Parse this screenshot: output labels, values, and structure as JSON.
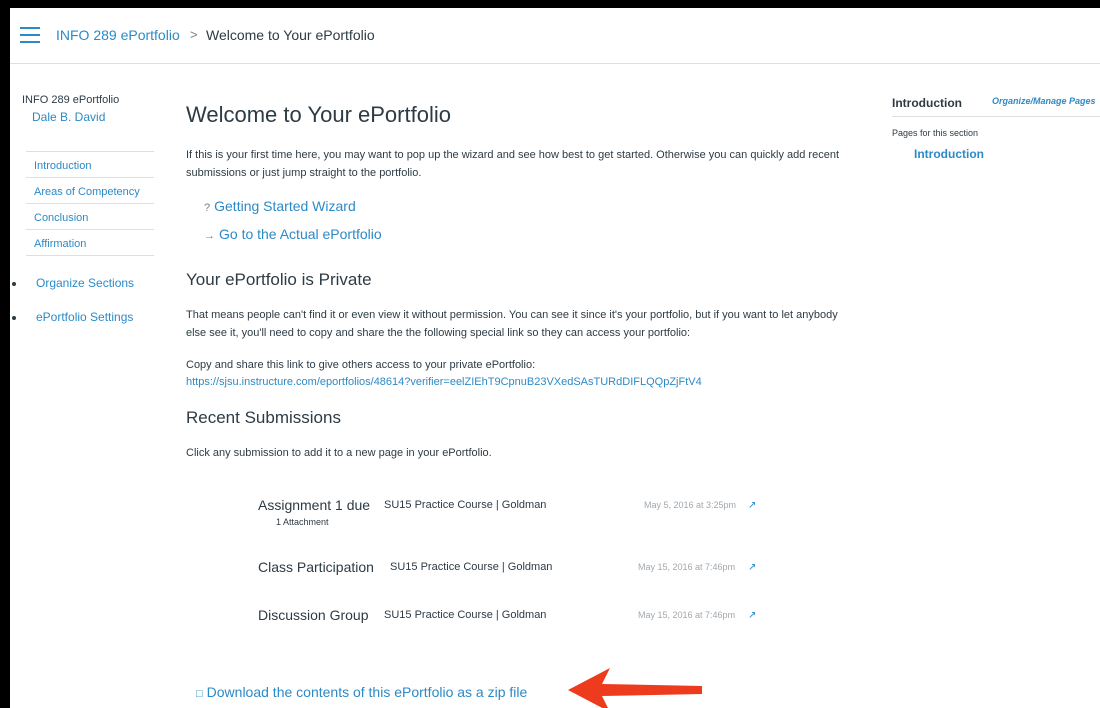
{
  "header": {
    "breadcrumb_link": "INFO 289 ePortfolio",
    "breadcrumb_separator": ">",
    "breadcrumb_current": "Welcome to Your ePortfolio"
  },
  "sidebar": {
    "course": "INFO 289 ePortfolio",
    "user": "Dale B. David",
    "sections": [
      "Introduction",
      "Areas of Competency",
      "Conclusion",
      "Affirmation"
    ],
    "organize_label": "Organize Sections",
    "settings_label": "ePortfolio Settings"
  },
  "main": {
    "title": "Welcome to Your ePortfolio",
    "intro": "If this is your first time here, you may want to pop up the wizard and see how best to get started. Otherwise you can quickly add recent submissions or just jump straight to the portfolio.",
    "wizard_icon": "?",
    "wizard_label": "Getting Started Wizard",
    "go_icon": "→",
    "go_label": "Go to the Actual ePortfolio",
    "private_heading": "Your ePortfolio is Private",
    "private_text": "That means people can't find it or even view it without permission. You can see it since it's your portfolio, but if you want to let anybody else see it, you'll need to copy and share the the following special link so they can access your portfolio:",
    "share_label": "Copy and share this link to give others access to your private ePortfolio:",
    "share_url": "https://sjsu.instructure.com/eportfolios/48614?verifier=eelZIEhT9CpnuB23VXedSAsTURdDIFLQQpZjFtV4",
    "recent_heading": "Recent Submissions",
    "recent_text": "Click any submission to add it to a new page in your ePortfolio.",
    "submissions": [
      {
        "title": "Assignment 1 due",
        "course": "SU15 Practice Course | Goldman",
        "date": "May 5, 2016 at 3:25pm",
        "attachments": "1 Attachment"
      },
      {
        "title": "Class Participation",
        "course": "SU15 Practice Course | Goldman",
        "date": "May 15, 2016 at 7:46pm",
        "attachments": ""
      },
      {
        "title": "Discussion Group",
        "course": "SU15 Practice Course | Goldman",
        "date": "May 15, 2016 at 7:46pm",
        "attachments": ""
      }
    ],
    "download_label": "Download the contents of this ePortfolio as a zip file"
  },
  "right_panel": {
    "title": "Introduction",
    "manage_label": "Organize/Manage Pages",
    "pages_label": "Pages for this section",
    "page_link": "Introduction"
  },
  "icons": {
    "menu": "hamburger-icon",
    "help": "question-circle-icon",
    "arrow": "arrow-right-icon",
    "external": "external-link-icon",
    "download": "document-icon",
    "annotation": "red-arrow-annotation"
  },
  "colors": {
    "link": "#2c8ac6",
    "text": "#2d3b45",
    "annotation_arrow": "#ec3b1d"
  }
}
